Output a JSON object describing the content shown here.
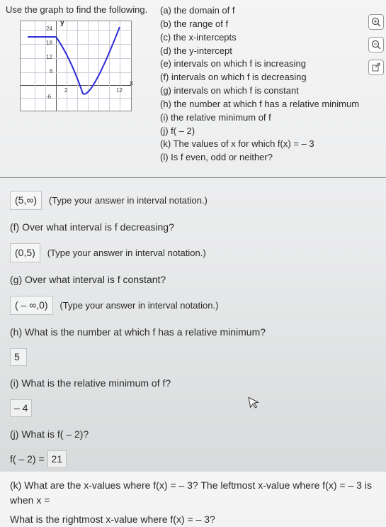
{
  "instruction": "Use the graph to find the following.",
  "graph": {
    "y_axis_label": "y",
    "x_axis_label": "x",
    "ticks": {
      "y24": "24",
      "y18": "18",
      "y12": "12",
      "y6": "6",
      "ym6": "-6",
      "x2": "2",
      "x12": "12"
    }
  },
  "toolbar": {
    "zoom_in": "⊕",
    "zoom_out": "⊖",
    "popout": "⇱"
  },
  "questions": {
    "a": "(a) the domain of f",
    "b": "(b) the range of f",
    "c": "(c) the x-intercepts",
    "d": "(d) the y-intercept",
    "e": "(e) intervals on which f is increasing",
    "f": "(f) intervals on which f is decreasing",
    "g": "(g) intervals on which f is constant",
    "h": "(h) the number at which f has a relative minimum",
    "i": "(i) the relative minimum of f",
    "j": "(j) f( – 2)",
    "k": "(k) The values of x for which f(x) = – 3",
    "l": "(l) Is f even, odd or neither?"
  },
  "work": {
    "ans_e": "(5,∞)",
    "hint_interval": "(Type your answer in interval notation.)",
    "q_f": "(f) Over what interval is f decreasing?",
    "ans_f": "(0,5)",
    "q_g": "(g) Over what interval is f constant?",
    "ans_g": "( – ∞,0)",
    "q_h": "(h) What is the number at which f has a relative minimum?",
    "ans_h": "5",
    "q_i": "(i) What is the relative minimum of f?",
    "ans_i": "– 4",
    "q_j": "(j)  What is f( – 2)?",
    "ans_j_prefix": "f( – 2) = ",
    "ans_j": "21",
    "q_k": "(k) What are the x-values where f(x) = – 3?  The leftmost x-value where f(x) = – 3 is when x =",
    "q_k2": "What is the rightmost x-value where f(x) = – 3?"
  },
  "chart_data": {
    "type": "line",
    "title": "",
    "xlabel": "x",
    "ylabel": "y",
    "xlim": [
      -4,
      12
    ],
    "ylim": [
      -6,
      24
    ],
    "x": [
      -4,
      -2,
      0,
      2,
      4,
      5,
      6,
      8,
      10,
      12
    ],
    "y": [
      21,
      21,
      21,
      11,
      -1,
      -4,
      -3,
      5,
      15,
      24
    ],
    "annotations": [
      "y-ticks at 6,12,18,24",
      "grid on"
    ]
  }
}
